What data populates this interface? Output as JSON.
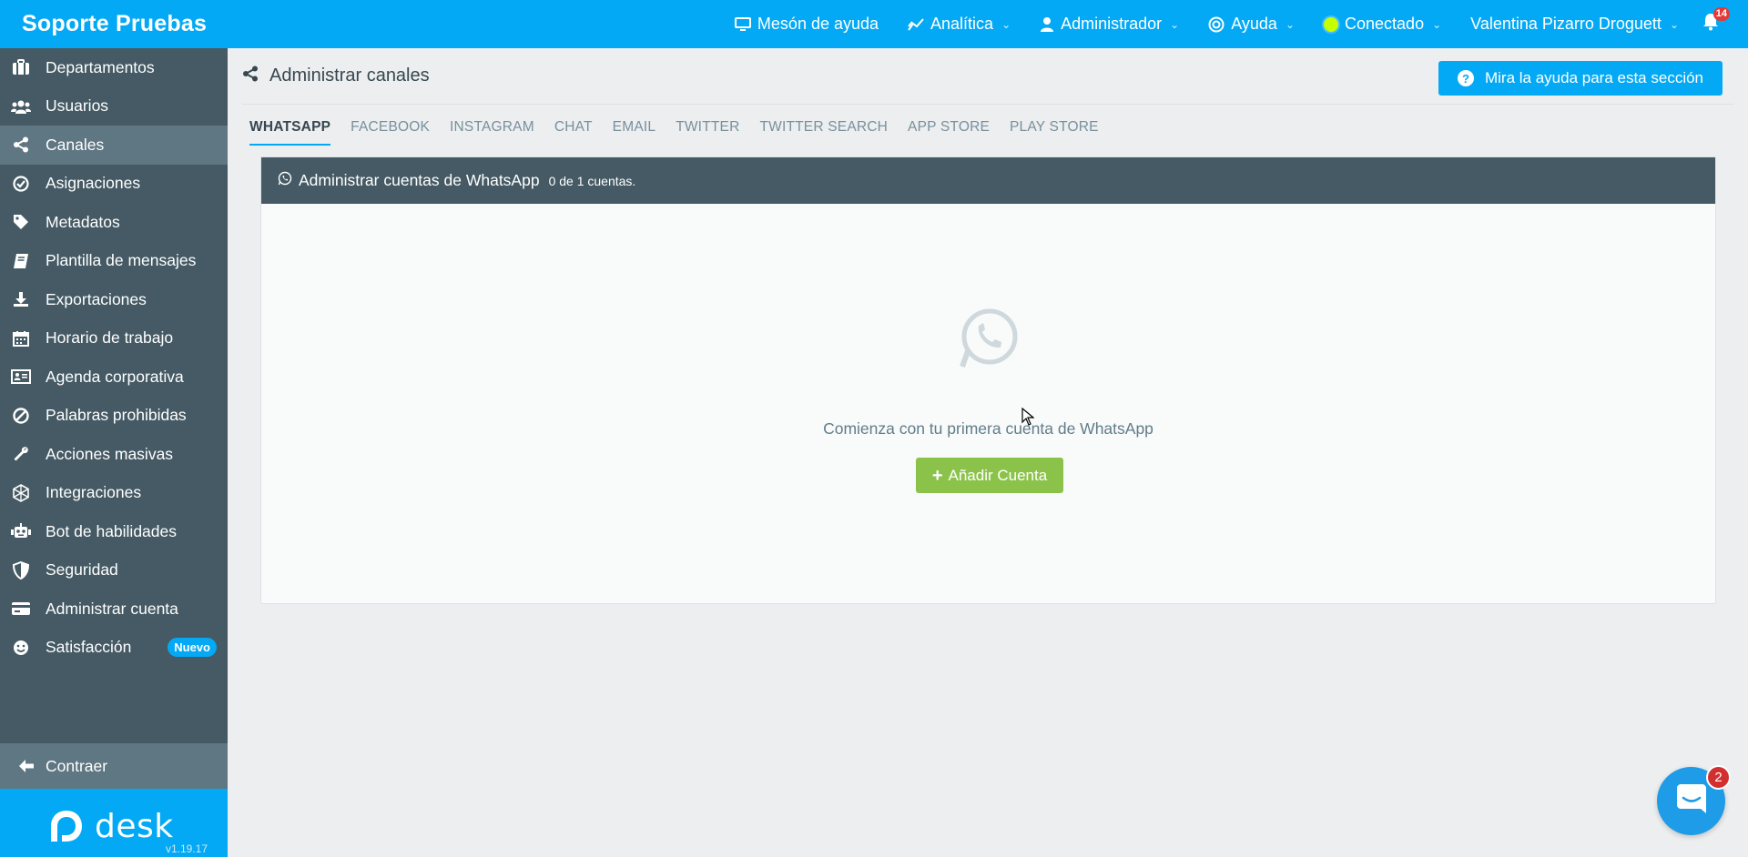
{
  "topbar": {
    "brand": "Soporte Pruebas",
    "items": [
      {
        "label": "Mesón de ayuda",
        "icon": "monitor-icon"
      },
      {
        "label": "Analítica",
        "icon": "chart-line-icon"
      },
      {
        "label": "Administrador",
        "icon": "user-tie-icon"
      },
      {
        "label": "Ayuda",
        "icon": "life-ring-icon"
      },
      {
        "label": "Conectado",
        "icon": "status-dot"
      },
      {
        "label": "Valentina Pizarro Droguett",
        "icon": ""
      }
    ],
    "notifications_count": "14",
    "status_color": "#c6ff00"
  },
  "sidebar": {
    "items": [
      {
        "label": "Departamentos",
        "icon": "briefcase-icon"
      },
      {
        "label": "Usuarios",
        "icon": "users-icon"
      },
      {
        "label": "Canales",
        "icon": "share-icon",
        "active": true
      },
      {
        "label": "Asignaciones",
        "icon": "check-circle-icon"
      },
      {
        "label": "Metadatos",
        "icon": "tag-icon"
      },
      {
        "label": "Plantilla de mensajes",
        "icon": "book-icon"
      },
      {
        "label": "Exportaciones",
        "icon": "download-icon"
      },
      {
        "label": "Horario de trabajo",
        "icon": "calendar-icon"
      },
      {
        "label": "Agenda corporativa",
        "icon": "address-card-icon"
      },
      {
        "label": "Palabras prohibidas",
        "icon": "ban-icon"
      },
      {
        "label": "Acciones masivas",
        "icon": "wrench-icon"
      },
      {
        "label": "Integraciones",
        "icon": "network-icon"
      },
      {
        "label": "Bot de habilidades",
        "icon": "robot-icon"
      },
      {
        "label": "Seguridad",
        "icon": "shield-icon"
      },
      {
        "label": "Administrar cuenta",
        "icon": "credit-card-icon"
      },
      {
        "label": "Satisfacción",
        "icon": "smile-icon",
        "badge": "Nuevo"
      }
    ],
    "collapse_label": "Contraer",
    "logo_text": "desk",
    "version": "v1.19.17"
  },
  "main": {
    "title": "Administrar canales",
    "help_button": "Mira la ayuda para esta sección",
    "tabs": [
      "WHATSAPP",
      "FACEBOOK",
      "INSTAGRAM",
      "CHAT",
      "EMAIL",
      "TWITTER",
      "TWITTER SEARCH",
      "APP STORE",
      "PLAY STORE"
    ],
    "active_tab": "WHATSAPP",
    "panel": {
      "title": "Administrar cuentas de WhatsApp",
      "count": "0 de 1 cuentas.",
      "empty_text": "Comienza con tu primera cuenta de WhatsApp",
      "add_button": "Añadir Cuenta"
    }
  },
  "chat_launcher": {
    "badge": "2"
  },
  "colors": {
    "primary": "#03a9f4",
    "sidebar": "#455a64",
    "success": "#8bc34a",
    "danger": "#e53935"
  }
}
